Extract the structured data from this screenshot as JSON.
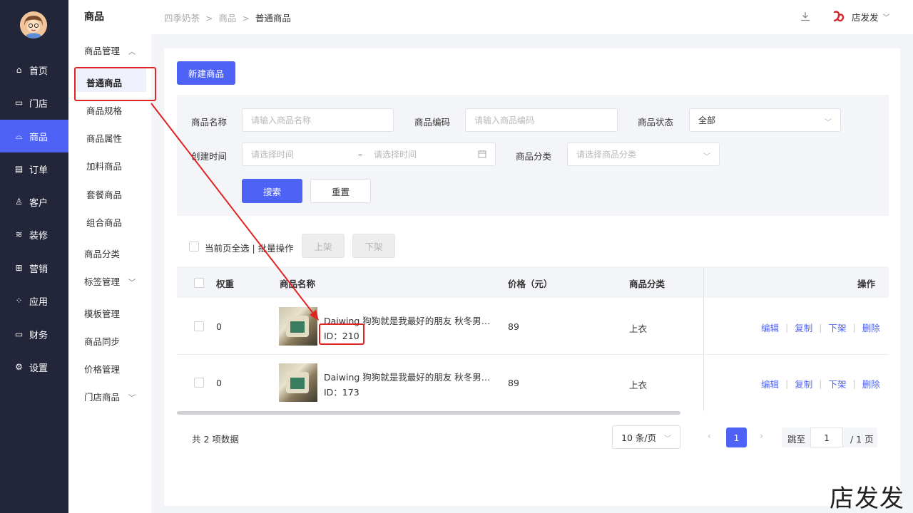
{
  "nav": {
    "items": [
      {
        "label": "首页",
        "icon": "home-icon"
      },
      {
        "label": "门店",
        "icon": "store-icon"
      },
      {
        "label": "商品",
        "icon": "bag-icon"
      },
      {
        "label": "订单",
        "icon": "order-icon"
      },
      {
        "label": "客户",
        "icon": "user-icon"
      },
      {
        "label": "装修",
        "icon": "layers-icon"
      },
      {
        "label": "营销",
        "icon": "gift-icon"
      },
      {
        "label": "应用",
        "icon": "apps-icon"
      },
      {
        "label": "财务",
        "icon": "wallet-icon"
      },
      {
        "label": "设置",
        "icon": "gear-icon"
      }
    ],
    "active_index": 2
  },
  "subnav": {
    "title": "商品",
    "group_product_mgmt": "商品管理",
    "children": [
      "普通商品",
      "商品规格",
      "商品属性",
      "加料商品",
      "套餐商品",
      "组合商品"
    ],
    "category": "商品分类",
    "tag_mgmt": "标签管理",
    "template_mgmt": "模板管理",
    "sync": "商品同步",
    "price_mgmt": "价格管理",
    "store_goods": "门店商品"
  },
  "header": {
    "crumb_1": "四季奶茶",
    "crumb_2": "商品",
    "crumb_3": "普通商品",
    "user_name": "店发发"
  },
  "toolbar": {
    "new_product": "新建商品"
  },
  "filter": {
    "name_label": "商品名称",
    "name_placeholder": "请输入商品名称",
    "code_label": "商品编码",
    "code_placeholder": "请输入商品编码",
    "status_label": "商品状态",
    "status_value": "全部",
    "created_label": "创建时间",
    "start_placeholder": "请选择时间",
    "range_sep": "–",
    "end_placeholder": "请选择时间",
    "category_label": "商品分类",
    "category_placeholder": "请选择商品分类",
    "search": "搜索",
    "reset": "重置"
  },
  "batch": {
    "select_all": "当前页全选 | 批量操作",
    "on_shelf": "上架",
    "off_shelf": "下架"
  },
  "table": {
    "headers": {
      "weight": "权重",
      "name": "商品名称",
      "price": "价格（元）",
      "category": "商品分类",
      "ops": "操作"
    },
    "rows": [
      {
        "weight": "0",
        "name": "Daiwing 狗狗就是我最好的朋友 秋冬男装卫衣",
        "id": "ID：210",
        "price": "89",
        "category": "上衣"
      },
      {
        "weight": "0",
        "name": "Daiwing 狗狗就是我最好的朋友 秋冬男装卫衣",
        "id": "ID：173",
        "price": "89",
        "category": "上衣"
      }
    ],
    "ops": {
      "edit": "编辑",
      "copy": "复制",
      "off": "下架",
      "delete": "删除"
    }
  },
  "pagination": {
    "total": "共 2 项数据",
    "page_size": "10 条/页",
    "current": "1",
    "jump_label": "跳至",
    "jump_value": "1",
    "total_pages": "/ 1 页"
  },
  "watermark": "店发发",
  "colors": {
    "primary": "#4e63f5",
    "sidebar": "#23263a",
    "annotation": "#e02424"
  }
}
